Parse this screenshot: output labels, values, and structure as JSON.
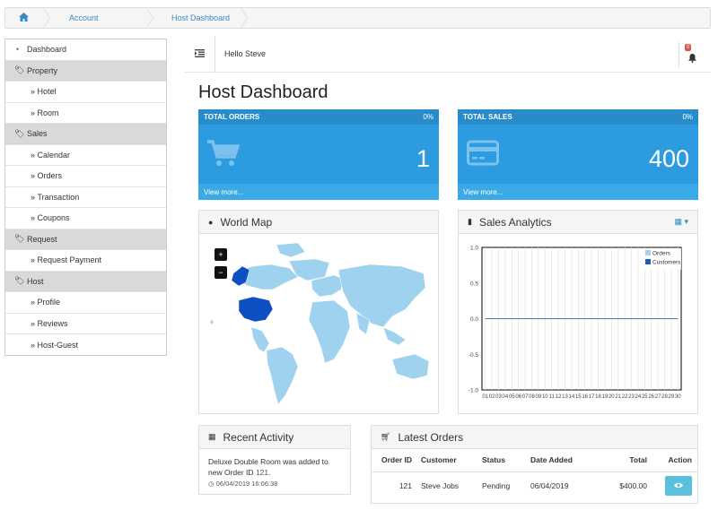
{
  "breadcrumb": {
    "home_icon": "home-icon",
    "items": [
      "Account",
      "Host Dashboard"
    ]
  },
  "sidebar": {
    "dashboard": "Dashboard",
    "sections": [
      {
        "label": "Property",
        "icon": "tags-icon",
        "items": [
          "Hotel",
          "Room"
        ]
      },
      {
        "label": "Sales",
        "icon": "tags-icon",
        "items": [
          "Calendar",
          "Orders",
          "Transaction",
          "Coupons"
        ]
      },
      {
        "label": "Request",
        "icon": "tags-icon",
        "items": [
          "Request Payment"
        ]
      },
      {
        "label": "Host",
        "icon": "tags-icon",
        "items": [
          "Profile",
          "Reviews",
          "Host-Guest"
        ]
      }
    ]
  },
  "topbar": {
    "greeting": "Hello Steve",
    "notification_count": "0"
  },
  "page_title": "Host Dashboard",
  "stats": [
    {
      "title": "TOTAL ORDERS",
      "percent": "0%",
      "value": "1",
      "link": "View more...",
      "icon": "cart-icon"
    },
    {
      "title": "TOTAL SALES",
      "percent": "0%",
      "value": "400",
      "link": "View more...",
      "icon": "credit-card-icon"
    }
  ],
  "world_map": {
    "title": "World Map",
    "zoom_in": "+",
    "zoom_out": "−"
  },
  "sales_analytics": {
    "title": "Sales Analytics"
  },
  "chart_data": {
    "type": "line",
    "x": [
      1,
      2,
      3,
      4,
      5,
      6,
      7,
      8,
      9,
      10,
      11,
      12,
      13,
      14,
      15,
      16,
      17,
      18,
      19,
      20,
      21,
      22,
      23,
      24,
      25,
      26,
      27,
      28,
      29,
      30
    ],
    "x_tick_labels": [
      "01",
      "02",
      "03",
      "04",
      "05",
      "06",
      "07",
      "08",
      "09",
      "10",
      "11",
      "12",
      "13",
      "14",
      "15",
      "16",
      "17",
      "18",
      "19",
      "20",
      "21",
      "22",
      "23",
      "24",
      "25",
      "26",
      "27",
      "28",
      "29",
      "30"
    ],
    "series": [
      {
        "name": "Orders",
        "color": "#a6cfec",
        "values": [
          0,
          0,
          0,
          0,
          0,
          0,
          0,
          0,
          0,
          0,
          0,
          0,
          0,
          0,
          0,
          0,
          0,
          0,
          0,
          0,
          0,
          0,
          0,
          0,
          0,
          0,
          0,
          0,
          0,
          0
        ]
      },
      {
        "name": "Customers",
        "color": "#1a5fb4",
        "values": [
          0,
          0,
          0,
          0,
          0,
          0,
          0,
          0,
          0,
          0,
          0,
          0,
          0,
          0,
          0,
          0,
          0,
          0,
          0,
          0,
          0,
          0,
          0,
          0,
          0,
          0,
          0,
          0,
          0,
          0
        ]
      }
    ],
    "ylim": [
      -1.0,
      1.0
    ],
    "y_ticks": [
      "1.0",
      "0.5",
      "0.0",
      "-0.5",
      "-1.0"
    ],
    "legend": "top-right",
    "grid": true
  },
  "recent_activity": {
    "title": "Recent Activity",
    "text": "Deluxe Double Room was added to new Order ID",
    "order_id": "121",
    "suffix": ".",
    "time": "06/04/2019 16:06:38"
  },
  "latest_orders": {
    "title": "Latest Orders",
    "columns": [
      "Order ID",
      "Customer",
      "Status",
      "Date Added",
      "Total",
      "Action"
    ],
    "rows": [
      {
        "order_id": "121",
        "customer": "Steve Jobs",
        "status": "Pending",
        "date": "06/04/2019",
        "total": "$400.00"
      }
    ]
  }
}
